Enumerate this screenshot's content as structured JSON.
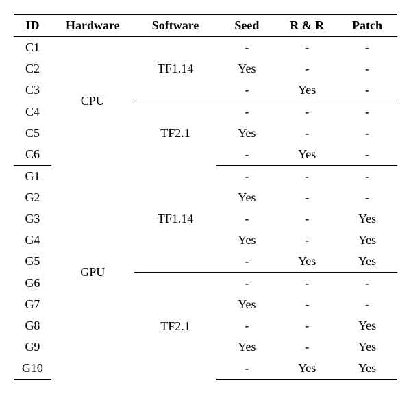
{
  "chart_data": {
    "type": "table",
    "columns": [
      "ID",
      "Hardware",
      "Software",
      "Seed",
      "R & R",
      "Patch"
    ],
    "rows": [
      {
        "id": "C1",
        "hardware": "CPU",
        "software": "TF1.14",
        "seed": "-",
        "rr": "-",
        "patch": "-"
      },
      {
        "id": "C2",
        "hardware": "CPU",
        "software": "TF1.14",
        "seed": "Yes",
        "rr": "-",
        "patch": "-"
      },
      {
        "id": "C3",
        "hardware": "CPU",
        "software": "TF1.14",
        "seed": "-",
        "rr": "Yes",
        "patch": "-"
      },
      {
        "id": "C4",
        "hardware": "CPU",
        "software": "TF2.1",
        "seed": "-",
        "rr": "-",
        "patch": "-"
      },
      {
        "id": "C5",
        "hardware": "CPU",
        "software": "TF2.1",
        "seed": "Yes",
        "rr": "-",
        "patch": "-"
      },
      {
        "id": "C6",
        "hardware": "CPU",
        "software": "TF2.1",
        "seed": "-",
        "rr": "Yes",
        "patch": "-"
      },
      {
        "id": "G1",
        "hardware": "GPU",
        "software": "TF1.14",
        "seed": "-",
        "rr": "-",
        "patch": "-"
      },
      {
        "id": "G2",
        "hardware": "GPU",
        "software": "TF1.14",
        "seed": "Yes",
        "rr": "-",
        "patch": "-"
      },
      {
        "id": "G3",
        "hardware": "GPU",
        "software": "TF1.14",
        "seed": "-",
        "rr": "-",
        "patch": "Yes"
      },
      {
        "id": "G4",
        "hardware": "GPU",
        "software": "TF1.14",
        "seed": "Yes",
        "rr": "-",
        "patch": "Yes"
      },
      {
        "id": "G5",
        "hardware": "GPU",
        "software": "TF1.14",
        "seed": "-",
        "rr": "Yes",
        "patch": "Yes"
      },
      {
        "id": "G6",
        "hardware": "GPU",
        "software": "TF2.1",
        "seed": "-",
        "rr": "-",
        "patch": "-"
      },
      {
        "id": "G7",
        "hardware": "GPU",
        "software": "TF2.1",
        "seed": "Yes",
        "rr": "-",
        "patch": "-"
      },
      {
        "id": "G8",
        "hardware": "GPU",
        "software": "TF2.1",
        "seed": "-",
        "rr": "-",
        "patch": "Yes"
      },
      {
        "id": "G9",
        "hardware": "GPU",
        "software": "TF2.1",
        "seed": "Yes",
        "rr": "-",
        "patch": "Yes"
      },
      {
        "id": "G10",
        "hardware": "GPU",
        "software": "TF2.1",
        "seed": "-",
        "rr": "Yes",
        "patch": "Yes"
      }
    ]
  },
  "headers": {
    "id": "ID",
    "hardware": "Hardware",
    "software": "Software",
    "seed": "Seed",
    "rr": "R & R",
    "patch": "Patch"
  },
  "merged": {
    "cpu": "CPU",
    "gpu": "GPU",
    "tf114": "TF1.14",
    "tf21": "TF2.1"
  },
  "rows": {
    "c1": {
      "id": "C1",
      "seed": "-",
      "rr": "-",
      "patch": "-"
    },
    "c2": {
      "id": "C2",
      "seed": "Yes",
      "rr": "-",
      "patch": "-"
    },
    "c3": {
      "id": "C3",
      "seed": "-",
      "rr": "Yes",
      "patch": "-"
    },
    "c4": {
      "id": "C4",
      "seed": "-",
      "rr": "-",
      "patch": "-"
    },
    "c5": {
      "id": "C5",
      "seed": "Yes",
      "rr": "-",
      "patch": "-"
    },
    "c6": {
      "id": "C6",
      "seed": "-",
      "rr": "Yes",
      "patch": "-"
    },
    "g1": {
      "id": "G1",
      "seed": "-",
      "rr": "-",
      "patch": "-"
    },
    "g2": {
      "id": "G2",
      "seed": "Yes",
      "rr": "-",
      "patch": "-"
    },
    "g3": {
      "id": "G3",
      "seed": "-",
      "rr": "-",
      "patch": "Yes"
    },
    "g4": {
      "id": "G4",
      "seed": "Yes",
      "rr": "-",
      "patch": "Yes"
    },
    "g5": {
      "id": "G5",
      "seed": "-",
      "rr": "Yes",
      "patch": "Yes"
    },
    "g6": {
      "id": "G6",
      "seed": "-",
      "rr": "-",
      "patch": "-"
    },
    "g7": {
      "id": "G7",
      "seed": "Yes",
      "rr": "-",
      "patch": "-"
    },
    "g8": {
      "id": "G8",
      "seed": "-",
      "rr": "-",
      "patch": "Yes"
    },
    "g9": {
      "id": "G9",
      "seed": "Yes",
      "rr": "-",
      "patch": "Yes"
    },
    "g10": {
      "id": "G10",
      "seed": "-",
      "rr": "Yes",
      "patch": "Yes"
    }
  }
}
